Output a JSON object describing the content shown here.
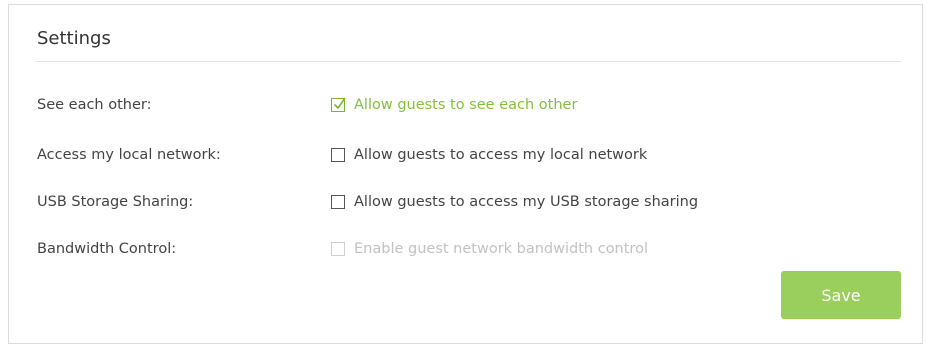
{
  "settings": {
    "title": "Settings",
    "rows": [
      {
        "label": "See each other:",
        "option": "Allow guests to see each other",
        "checked": true,
        "disabled": false
      },
      {
        "label": "Access my local network:",
        "option": "Allow guests to access my local network",
        "checked": false,
        "disabled": false
      },
      {
        "label": "USB Storage Sharing:",
        "option": "Allow guests to access my USB storage sharing",
        "checked": false,
        "disabled": false
      },
      {
        "label": "Bandwidth Control:",
        "option": "Enable guest network bandwidth control",
        "checked": false,
        "disabled": true
      }
    ],
    "save_label": "Save"
  },
  "colors": {
    "accent_green": "#85bf3f",
    "button_green": "#9bcf5d",
    "disabled_gray": "#c2c2c2"
  }
}
